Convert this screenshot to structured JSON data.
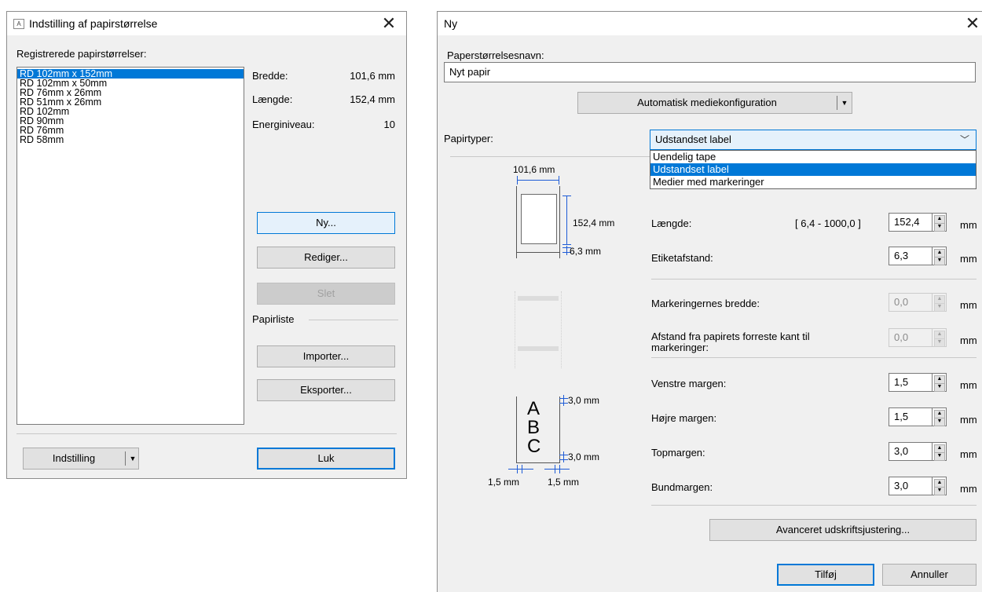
{
  "left": {
    "title": "Indstilling af papirstørrelse",
    "list_label": "Registrerede papirstørrelser:",
    "items": [
      "RD 102mm x 152mm",
      "RD 102mm x 50mm",
      "RD 76mm x 26mm",
      "RD 51mm x 26mm",
      "RD 102mm",
      "RD 90mm",
      "RD 76mm",
      "RD 58mm"
    ],
    "selected_index": 0,
    "width_label": "Bredde:",
    "width_value": "101,6 mm",
    "length_label": "Længde:",
    "length_value": "152,4 mm",
    "energy_label": "Energiniveau:",
    "energy_value": "10",
    "btn_new": "Ny...",
    "btn_edit": "Rediger...",
    "btn_delete": "Slet",
    "paperlist_label": "Papirliste",
    "btn_import": "Importer...",
    "btn_export": "Eksporter...",
    "btn_settings": "Indstilling",
    "btn_close": "Luk",
    "close_glyph": "✕"
  },
  "right": {
    "title": "Ny",
    "close_glyph": "✕",
    "name_label": "Paperstørrelsesnavn:",
    "name_value": "Nyt papir",
    "auto_btn": "Automatisk mediekonfiguration",
    "papertypes_label": "Papirtyper:",
    "papertype_selected": "Udstandset label",
    "papertype_options": [
      "Uendelig tape",
      "Udstandset label",
      "Medier med markeringer"
    ],
    "length_label": "Længde:",
    "length_range": "[ 6,4 - 1000,0 ]",
    "length_value": "152,4",
    "gap_label": "Etiketafstand:",
    "gap_value": "6,3",
    "markwidth_label": "Markeringernes bredde:",
    "markwidth_value": "0,0",
    "markdist_label_1": "Afstand fra papirets forreste kant til",
    "markdist_label_2": "markeringer:",
    "markdist_value": "0,0",
    "leftmargin_label": "Venstre margen:",
    "leftmargin_value": "1,5",
    "rightmargin_label": "Højre margen:",
    "rightmargin_value": "1,5",
    "topmargin_label": "Topmargen:",
    "topmargin_value": "3,0",
    "bottommargin_label": "Bundmargen:",
    "bottommargin_value": "3,0",
    "unit": "mm",
    "advanced_btn": "Avanceret udskriftsjustering...",
    "add_btn": "Tilføj",
    "cancel_btn": "Annuller",
    "dim_width": "101,6 mm",
    "dim_length": "152,4 mm",
    "dim_gap": "6,3 mm",
    "dim_top": "3,0 mm",
    "dim_bottom": "3,0 mm",
    "dim_left": "1,5 mm",
    "dim_right": "1,5 mm",
    "abc_a": "A",
    "abc_b": "B",
    "abc_c": "C"
  },
  "colors": {
    "accent": "#0078d7",
    "dimension_blue": "#1e5bd6"
  }
}
